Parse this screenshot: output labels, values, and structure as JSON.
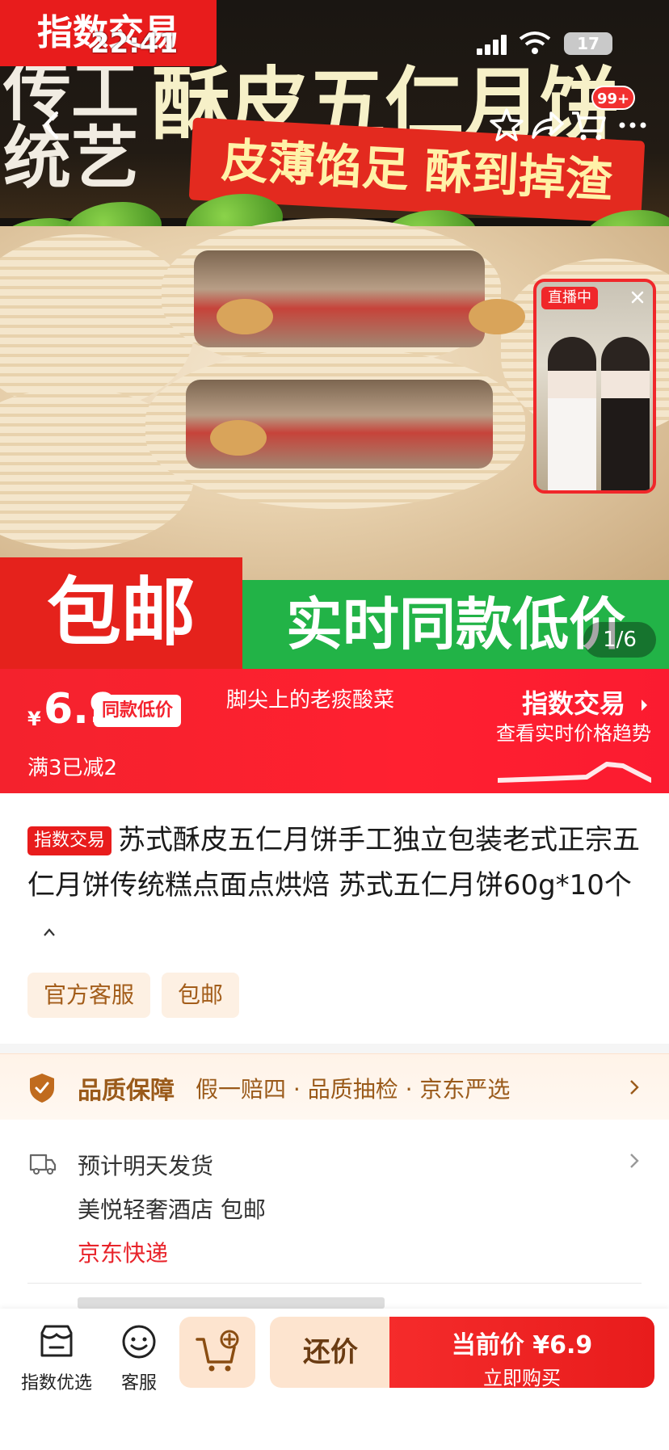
{
  "status_bar": {
    "time": "22:41",
    "battery": "17"
  },
  "hero": {
    "corner_badge": "指数交易",
    "side_text_col1": "传统",
    "side_text_col2": "工艺",
    "title": "酥皮五仁月饼",
    "subtitle": "皮薄馅足 酥到掉渣",
    "banner_left": "包邮",
    "banner_right": "实时同款低价",
    "page_indicator": "1/6",
    "cart_count": "99+",
    "live_tag": "直播中"
  },
  "price_bar": {
    "currency": "¥",
    "price": "6.9",
    "price_tag": "同款低价",
    "shop_name": "脚尖上的老痰酸菜",
    "promo": "满3已减2",
    "index_link": "指数交易",
    "index_sub": "查看实时价格趋势"
  },
  "product": {
    "badge": "指数交易",
    "title": "苏式酥皮五仁月饼手工独立包装老式正宗五仁月饼传统糕点面点烘焙 苏式五仁月饼60g*10个",
    "chips": [
      "官方客服",
      "包邮"
    ]
  },
  "quality": {
    "title": "品质保障",
    "desc": "假一赔四 · 品质抽检 · 京东严选"
  },
  "shipping": {
    "line1": "预计明天发货",
    "line2": "美悦轻奢酒店  包邮",
    "line3": "京东快递"
  },
  "bottom_bar": {
    "index_select": "指数优选",
    "service": "客服",
    "bargain": "还价",
    "buy_line1": "当前价 ¥6.9",
    "buy_line2": "立即购买"
  },
  "colors": {
    "brand_red": "#e81c1c",
    "price_bar": "#f4222d",
    "green_banner": "#22b347",
    "chip_bg": "#fdf0e3",
    "quality_text": "#9a5a1a"
  }
}
